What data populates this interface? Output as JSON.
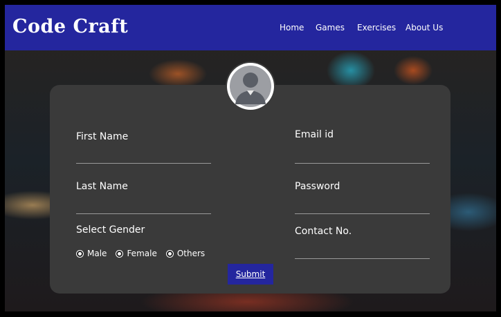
{
  "brand": {
    "logo_text": "Code Craft"
  },
  "nav": {
    "items": [
      {
        "label": "Home"
      },
      {
        "label": "Games"
      },
      {
        "label": "Exercises"
      },
      {
        "label": "About Us"
      }
    ]
  },
  "form": {
    "avatar_icon": "user-avatar-icon",
    "first_name": {
      "label": "First Name",
      "value": ""
    },
    "last_name": {
      "label": "Last Name",
      "value": ""
    },
    "email": {
      "label": "Email id",
      "value": ""
    },
    "password": {
      "label": "Password",
      "value": ""
    },
    "contact": {
      "label": "Contact No.",
      "value": ""
    },
    "gender": {
      "label": "Select Gender",
      "options": [
        {
          "label": "Male"
        },
        {
          "label": "Female"
        },
        {
          "label": "Others"
        }
      ]
    },
    "submit_label": "Submit"
  },
  "colors": {
    "navbar": "#24269e",
    "card": "#3a3a3a",
    "text": "#ffffff",
    "button": "#24269e"
  }
}
